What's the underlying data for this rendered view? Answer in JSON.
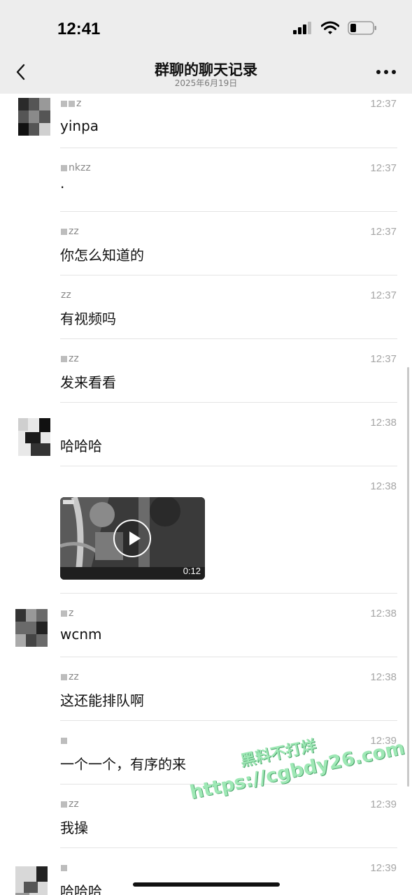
{
  "status": {
    "time": "12:41"
  },
  "nav": {
    "title": "群聊的聊天记录",
    "subtitle": "2025年6月19日"
  },
  "messages": [
    {
      "sender": "z",
      "time": "12:37",
      "text": "yinpa"
    },
    {
      "sender": "nkzz",
      "time": "12:37",
      "text": "."
    },
    {
      "sender": "zz",
      "time": "12:37",
      "text": "你怎么知道的"
    },
    {
      "sender": "zz",
      "time": "12:37",
      "text": "有视频吗"
    },
    {
      "sender": "zz",
      "time": "12:37",
      "text": "发来看看"
    },
    {
      "sender": "",
      "time": "12:38",
      "text": "哈哈哈"
    },
    {
      "sender": "",
      "time": "12:38",
      "video_duration": "0:12"
    },
    {
      "sender": "z",
      "time": "12:38",
      "text": "wcnm"
    },
    {
      "sender": "zz",
      "time": "12:38",
      "text": "这还能排队啊"
    },
    {
      "sender": "",
      "time": "12:39",
      "text": "一个一个，有序的来"
    },
    {
      "sender": "zz",
      "time": "12:39",
      "text": "我操"
    },
    {
      "sender": "",
      "time": "12:39",
      "text": "哈哈哈"
    }
  ],
  "watermark": {
    "line1": "黑料不打烊",
    "line2": "https://cgbdy26.com"
  }
}
